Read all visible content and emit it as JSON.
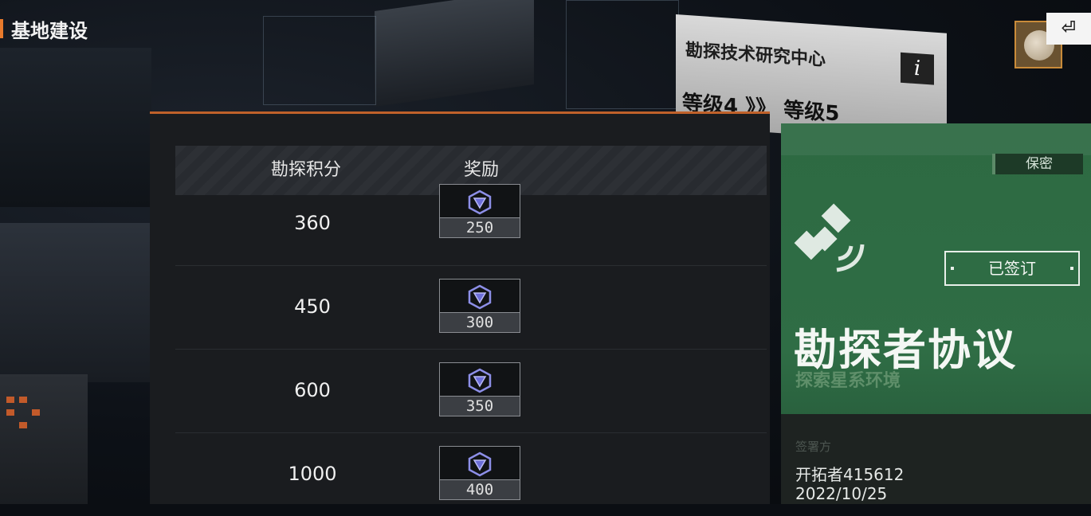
{
  "header": {
    "title": "基地建设"
  },
  "facility": {
    "name": "勘探技术研究中心",
    "info_icon": "i",
    "level_text": "等级4 》》 等级5"
  },
  "top_right": {
    "exit_label": "⏎",
    "avatar_icon": "moon-avatar-icon"
  },
  "rewards_table": {
    "columns": [
      "勘探积分",
      "奖励"
    ],
    "rows": [
      {
        "score": "360",
        "reward_qty": "250"
      },
      {
        "score": "450",
        "reward_qty": "300"
      },
      {
        "score": "600",
        "reward_qty": "350"
      },
      {
        "score": "1000",
        "reward_qty": "400"
      }
    ],
    "reward_icon": "v-gem-icon"
  },
  "agreement_card": {
    "secret_tag": "保密",
    "signed_label": "已签订",
    "title": "勘探者协议",
    "subtitle": "探索星系环境",
    "signer_label": "签署方",
    "signer": "开拓者415612",
    "date": "2022/10/25",
    "icon": "satellite-icon"
  },
  "colors": {
    "accent": "#e87a2c",
    "card_green": "#2f6d45",
    "panel": "#1a1c1f"
  }
}
